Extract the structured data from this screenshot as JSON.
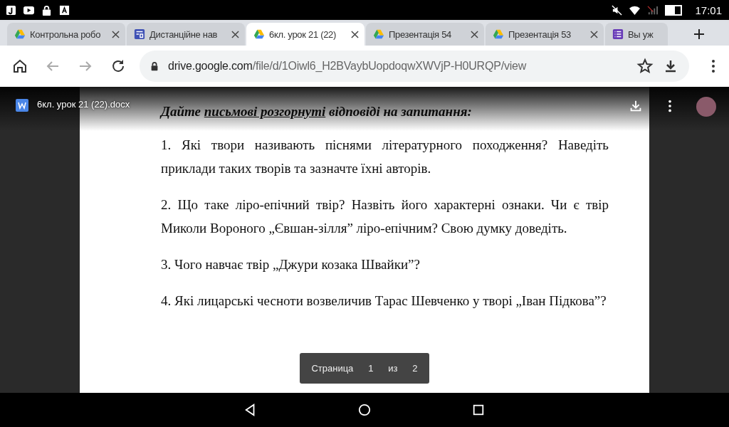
{
  "status_bar": {
    "time": "17:01"
  },
  "tabs": [
    {
      "title": "Контрольна робо",
      "kind": "drive",
      "selected": false
    },
    {
      "title": "Дистанційне нав",
      "kind": "forms",
      "selected": false
    },
    {
      "title": "6кл. урок 21 (22)",
      "kind": "drive",
      "selected": true
    },
    {
      "title": "Презентація 54",
      "kind": "drive",
      "selected": false
    },
    {
      "title": "Презентація 53",
      "kind": "drive",
      "selected": false
    },
    {
      "title": "Вы уж",
      "kind": "list",
      "selected": false
    }
  ],
  "address_bar": {
    "host": "drive.google.com",
    "path": "/file/d/1Oiwl6_H2BVaybUopdoqwXWVjP-H0URQP/view"
  },
  "viewer": {
    "file_name": "6кл. урок 21 (22).docx"
  },
  "document": {
    "heading": [
      {
        "text": "Дайте ",
        "underlined": false
      },
      {
        "text": "письмові розгорнуті",
        "underlined": true
      },
      {
        "text": " відповіді на запитання:",
        "underlined": false
      }
    ],
    "paragraphs": [
      "1. Які твори називають піснями літературного походження? Наведіть приклади таких творів та зазначте їхні авторів.",
      "2. Що таке ліро-епічний твір? Назвіть його характерні ознаки. Чи є твір Миколи Вороного „Євшан-зілля” ліро-епічним? Свою думку доведіть.",
      "3. Чого навчає твір „Джури козака Швайки”?",
      "4. Які лицарські чесноти возвеличив Тарас Шевченко у творі „Іван Підкова”?"
    ]
  },
  "page_indicator": {
    "label": "Страница",
    "current": "1",
    "separator": "из",
    "total": "2"
  }
}
